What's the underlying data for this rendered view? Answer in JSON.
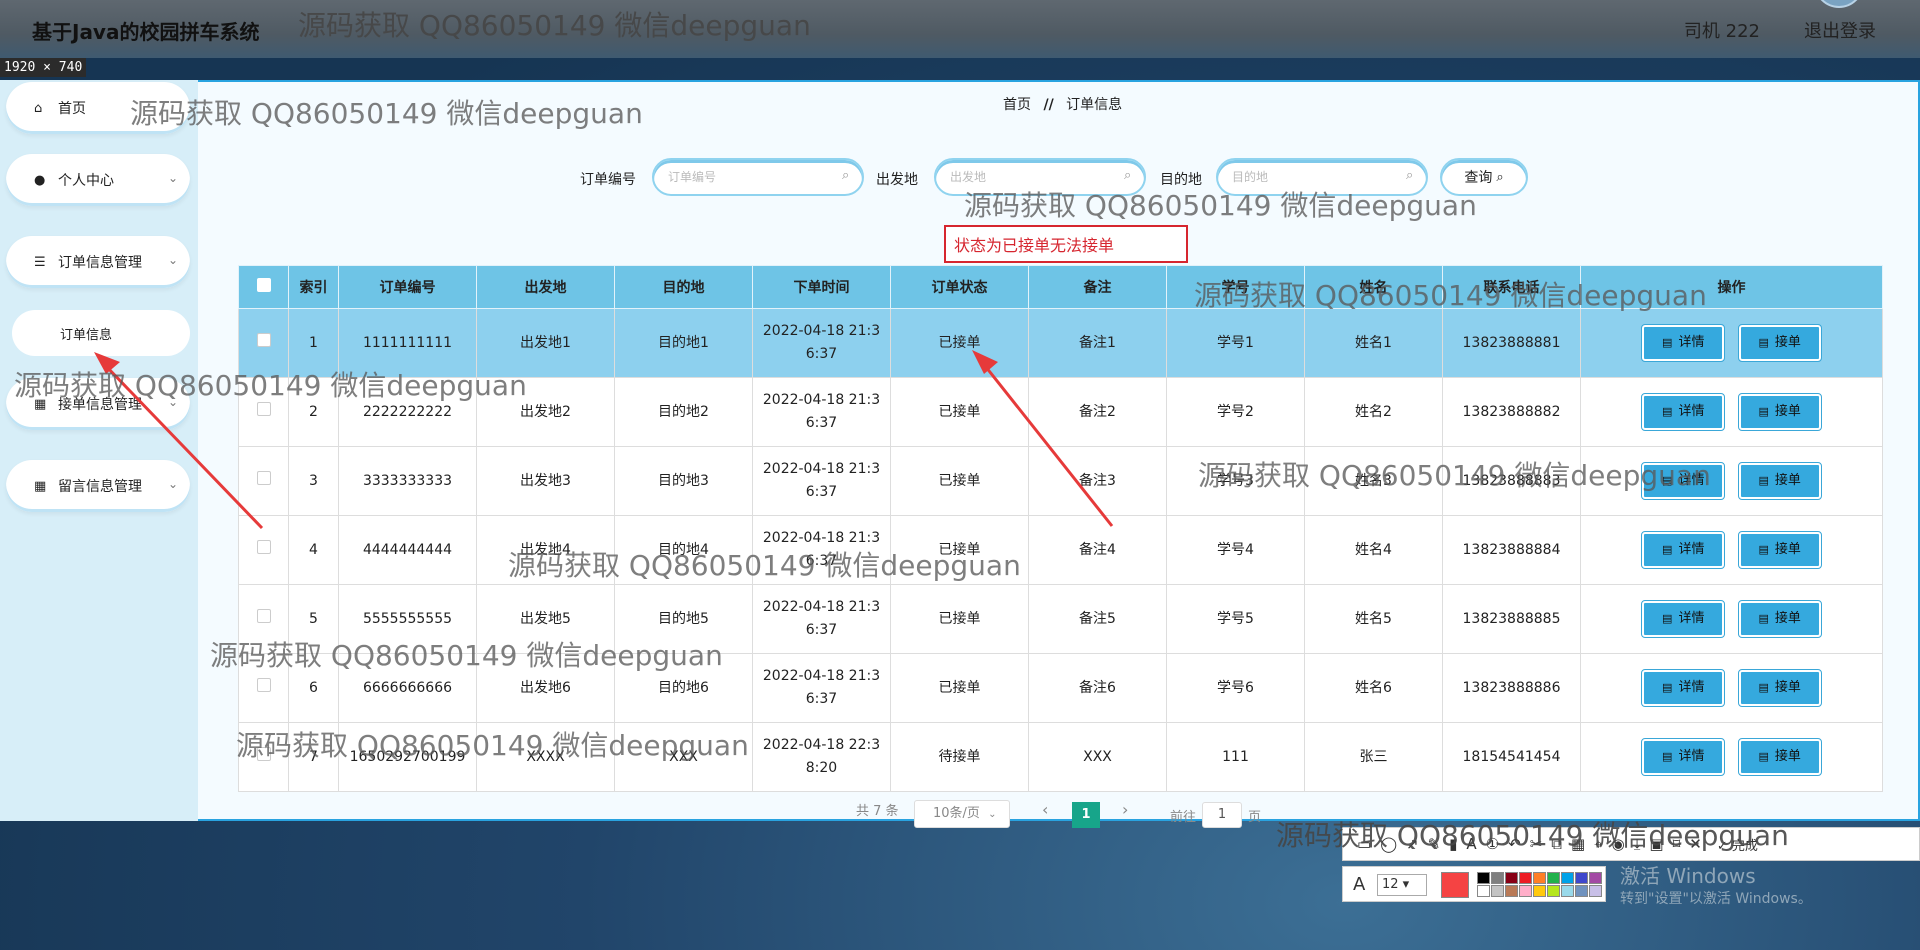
{
  "app": {
    "title": "基于Java的校园拼车系统",
    "user": "司机 222",
    "logout": "退出登录",
    "size_label": "1920 × 740"
  },
  "sidebar": {
    "items": [
      {
        "label": "首页",
        "icon": "home-icon"
      },
      {
        "label": "个人中心",
        "icon": "user-icon"
      },
      {
        "label": "订单信息管理",
        "icon": "list-icon"
      },
      {
        "label": "订单信息",
        "icon": ""
      },
      {
        "label": "接单信息管理",
        "icon": "grid-icon"
      },
      {
        "label": "留言信息管理",
        "icon": "grid-icon"
      }
    ]
  },
  "breadcrumb": {
    "home": "首页",
    "sep": "//",
    "current": "订单信息"
  },
  "search": {
    "order_no_label": "订单编号",
    "order_no_placeholder": "订单编号",
    "origin_label": "出发地",
    "origin_placeholder": "出发地",
    "dest_label": "目的地",
    "dest_placeholder": "目的地",
    "query_button": "查询"
  },
  "annotation": {
    "text": "状态为已接单无法接单"
  },
  "table": {
    "headers": [
      "索引",
      "订单编号",
      "出发地",
      "目的地",
      "下单时间",
      "订单状态",
      "备注",
      "学号",
      "姓名",
      "联系电话",
      "操作"
    ],
    "detail_label": "详情",
    "accept_label": "接单",
    "rows": [
      {
        "idx": "1",
        "no": "1111111111",
        "from": "出发地1",
        "to": "目的地1",
        "time1": "2022-04-18 21:3",
        "time2": "6:37",
        "status": "已接单",
        "note": "备注1",
        "sid": "学号1",
        "name": "姓名1",
        "phone": "13823888881"
      },
      {
        "idx": "2",
        "no": "2222222222",
        "from": "出发地2",
        "to": "目的地2",
        "time1": "2022-04-18 21:3",
        "time2": "6:37",
        "status": "已接单",
        "note": "备注2",
        "sid": "学号2",
        "name": "姓名2",
        "phone": "13823888882"
      },
      {
        "idx": "3",
        "no": "3333333333",
        "from": "出发地3",
        "to": "目的地3",
        "time1": "2022-04-18 21:3",
        "time2": "6:37",
        "status": "已接单",
        "note": "备注3",
        "sid": "学号3",
        "name": "姓名3",
        "phone": "13823888883"
      },
      {
        "idx": "4",
        "no": "4444444444",
        "from": "出发地4",
        "to": "目的地4",
        "time1": "2022-04-18 21:3",
        "time2": "6:37",
        "status": "已接单",
        "note": "备注4",
        "sid": "学号4",
        "name": "姓名4",
        "phone": "13823888884"
      },
      {
        "idx": "5",
        "no": "5555555555",
        "from": "出发地5",
        "to": "目的地5",
        "time1": "2022-04-18 21:3",
        "time2": "6:37",
        "status": "已接单",
        "note": "备注5",
        "sid": "学号5",
        "name": "姓名5",
        "phone": "13823888885"
      },
      {
        "idx": "6",
        "no": "6666666666",
        "from": "出发地6",
        "to": "目的地6",
        "time1": "2022-04-18 21:3",
        "time2": "6:37",
        "status": "已接单",
        "note": "备注6",
        "sid": "学号6",
        "name": "姓名6",
        "phone": "13823888886"
      },
      {
        "idx": "7",
        "no": "1650292700199",
        "from": "XXXX",
        "to": "XXX",
        "time1": "2022-04-18 22:3",
        "time2": "8:20",
        "status": "待接单",
        "note": "XXX",
        "sid": "111",
        "name": "张三",
        "phone": "18154541454"
      }
    ]
  },
  "pagination": {
    "total": "共 7 条",
    "page_size": "10条/页",
    "prev": "‹",
    "current": "1",
    "next": "›",
    "goto_label": "前往",
    "goto_value": "1",
    "page_suffix": "页"
  },
  "toolbar": {
    "done": "完成",
    "font_size": "12",
    "current_color": "#f54343",
    "palette": [
      "#000000",
      "#7f7f7f",
      "#880015",
      "#ed1c24",
      "#ff7f27",
      "#22b14c",
      "#00a2e8",
      "#3f48cc",
      "#a349a4",
      "#ffffff",
      "#c3c3c3",
      "#b97a57",
      "#ffaec9",
      "#ffc90e",
      "#b5e61d",
      "#99d9ea",
      "#7092be",
      "#c8bfe7"
    ]
  },
  "windows": {
    "activate_title": "激活 Windows",
    "activate_sub": "转到\"设置\"以激活 Windows。"
  },
  "watermark": {
    "text": "源码获取 QQ86050149 微信deepguan"
  },
  "colors": {
    "accent": "#35a9de",
    "header": "#6ec4e6",
    "highlight": "#8dd0ee",
    "annotation": "#d6262f",
    "page_active": "#17a58a"
  }
}
